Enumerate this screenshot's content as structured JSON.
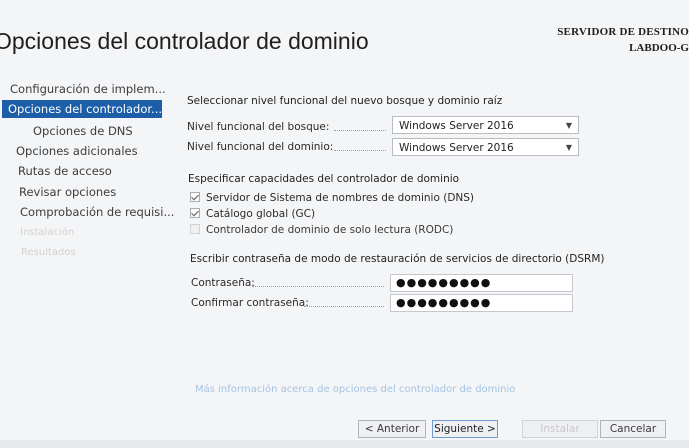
{
  "header": {
    "title": "Opciones del controlador de dominio",
    "destination_label": "SERVIDOR DE DESTINO",
    "destination_server": "LABDOO-G"
  },
  "nav": {
    "items": [
      {
        "label": "Configuración de implem...",
        "state": "normal"
      },
      {
        "label": "Opciones del controlador...",
        "state": "selected"
      },
      {
        "label": "Opciones de DNS",
        "state": "sub"
      },
      {
        "label": "Opciones adicionales",
        "state": "normal"
      },
      {
        "label": "Rutas de acceso",
        "state": "normal"
      },
      {
        "label": "Revisar opciones",
        "state": "normal"
      },
      {
        "label": "Comprobación de requisi...",
        "state": "normal"
      },
      {
        "label": "Instalación",
        "state": "disabled"
      },
      {
        "label": "Resultados",
        "state": "disabled"
      }
    ]
  },
  "functional_level": {
    "heading": "Seleccionar nivel funcional del nuevo bosque y dominio raíz",
    "forest_label": "Nivel funcional del bosque:",
    "forest_value": "Windows Server 2016",
    "domain_label": "Nivel funcional del dominio:",
    "domain_value": "Windows Server 2016"
  },
  "capabilities": {
    "heading": "Especificar capacidades del controlador de dominio",
    "items": [
      {
        "label": "Servidor de Sistema de nombres de dominio (DNS)",
        "checked": true,
        "enabled": true
      },
      {
        "label": "Catálogo global (GC)",
        "checked": true,
        "enabled": true
      },
      {
        "label": "Controlador de dominio de solo lectura (RODC)",
        "checked": false,
        "enabled": false
      }
    ]
  },
  "dsrm": {
    "heading": "Escribir contraseña de modo de restauración de servicios de directorio (DSRM)",
    "password_label": "Contraseña:",
    "password_value": "●●●●●●●●●",
    "confirm_label": "Confirmar contraseña:",
    "confirm_value": "●●●●●●●●●"
  },
  "more_info_link": "Más información acerca de opciones del controlador de dominio",
  "buttons": {
    "previous": "< Anterior",
    "next": "Siguiente >",
    "install": "Instalar",
    "cancel": "Cancelar"
  },
  "colors": {
    "accent": "#1c5fa8",
    "link": "#a5c3e3",
    "background": "#f4f5f7"
  }
}
